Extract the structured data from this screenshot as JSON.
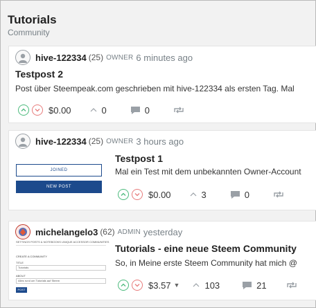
{
  "page": {
    "title": "Tutorials",
    "subtitle": "Community"
  },
  "posts": [
    {
      "author": "hive-122334",
      "reputation": "(25)",
      "role": "OWNER",
      "time": "6 minutes ago",
      "title": "Testpost 2",
      "body": "Post über Steempeak.com geschrieben mit hive-122334 als ersten Tag. Mal",
      "payout": "$0.00",
      "votes": "0",
      "comments": "0"
    },
    {
      "author": "hive-122334",
      "reputation": "(25)",
      "role": "OWNER",
      "time": "3 hours ago",
      "title": "Testpost 1",
      "body": "Mal ein Test mit dem unbekannten Owner-Account",
      "payout": "$0.00",
      "votes": "3",
      "comments": "0",
      "thumbnail": {
        "joined_label": "JOINED",
        "newpost_label": "NEW POST"
      }
    },
    {
      "author": "michelangelo3",
      "reputation": "(62)",
      "role": "ADMIN",
      "time": "yesterday",
      "title": "Tutorials - eine neue Steem Community",
      "body": "So, in Meine erste Steem Community hat mich @",
      "payout": "$3.57",
      "votes": "103",
      "comments": "21",
      "thumbnail": {
        "tabs": "SETTINGS   POSTS & NOTEBOOKS   UNIQUE ACCESSOR   COMMUNITIES",
        "heading": "CREATE A COMMUNITY",
        "field1_label": "TITLE",
        "field1_value": "Tutorials",
        "field2_label": "ABOUT",
        "field2_value": "Alles rund um Tutorials auf Steem",
        "button": "POST"
      }
    }
  ],
  "colors": {
    "upvote": "#4bba7c",
    "downvote": "#e77b7b",
    "brand_blue": "#1c4a8c",
    "muted": "#788187"
  },
  "icons": {
    "upvote": "chevron-up-icon",
    "downvote": "chevron-down-icon",
    "votes": "caret-up-icon",
    "comments": "comment-icon",
    "reblog": "reblog-icon"
  }
}
